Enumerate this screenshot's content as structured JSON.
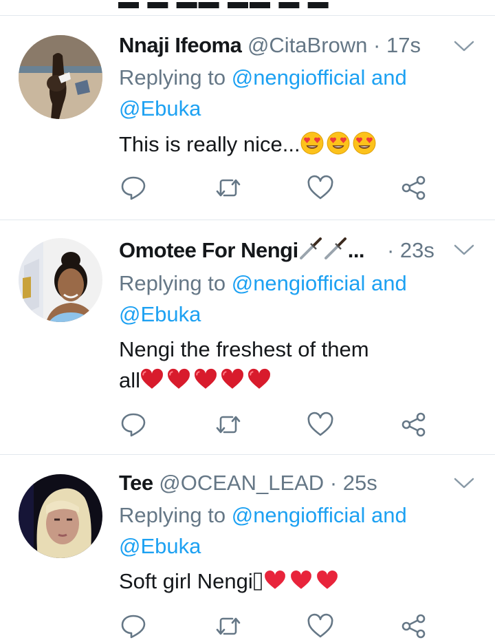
{
  "tweets": [
    {
      "name": "Nnaji Ifeoma",
      "handle": "@CitaBrown",
      "time": "· 17s",
      "reply_prefix": "Replying to",
      "mention1": "@nengiofficial",
      "and": "and",
      "mention2": "@Ebuka",
      "text": "This is really nice...",
      "emoji": "heart-eyes"
    },
    {
      "name": "Omotee For Nengi",
      "name_suffix": "...",
      "handle": "",
      "time": "· 23s",
      "reply_prefix": "Replying to",
      "mention1": "@nengiofficial",
      "and": "and",
      "mention2": "@Ebuka",
      "text": "Nengi the freshest of them",
      "text2": "all",
      "emoji": "red-heart"
    },
    {
      "name": "Tee",
      "handle": "@OCEAN_LEAD",
      "time": "· 25s",
      "reply_prefix": "Replying to",
      "mention1": "@nengiofficial",
      "and": "and",
      "mention2": "@Ebuka",
      "text": "Soft girl Nengi",
      "emoji": "heart"
    }
  ],
  "icons": {
    "reply": "reply-icon",
    "retweet": "retweet-icon",
    "like": "like-icon",
    "share": "share-icon",
    "more": "chevron-down-icon"
  },
  "colors": {
    "accent": "#1da1f2",
    "secondary_text": "#657786",
    "primary_text": "#14171a",
    "divider": "#e1e8ed",
    "heart_red": "#e0245e"
  }
}
